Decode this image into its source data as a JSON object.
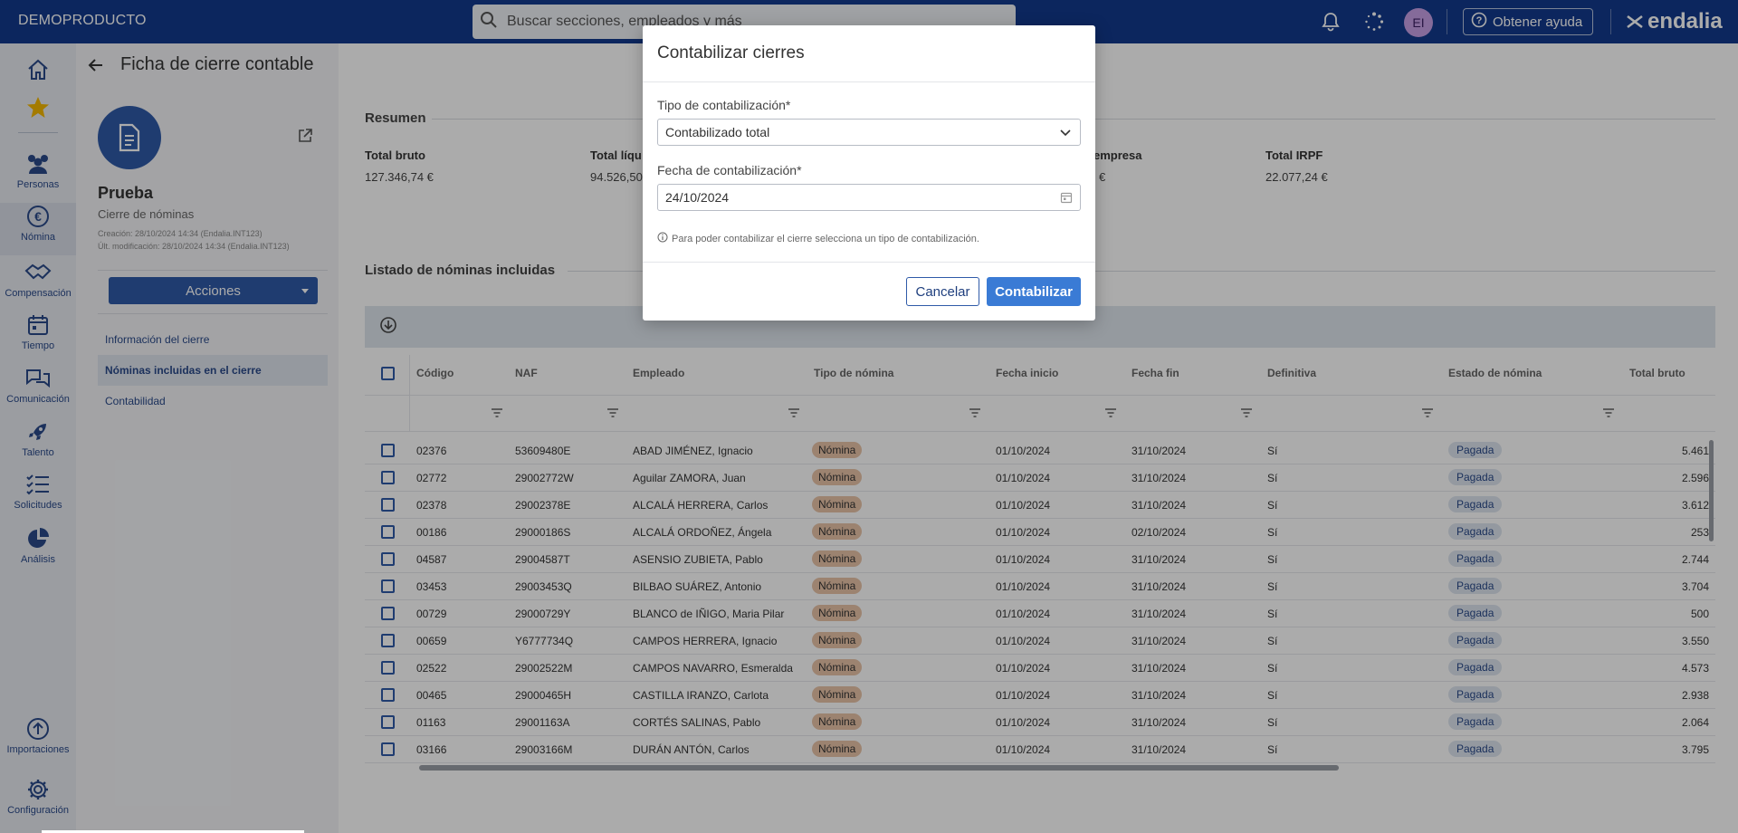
{
  "app": {
    "brand": "DEMOPRODUCTO",
    "search_placeholder": "Buscar secciones, empleados y más",
    "avatar_initials": "EI",
    "help_label": "Obtener ayuda",
    "logo_text": "endalia"
  },
  "rail": {
    "items": [
      {
        "label": "",
        "icon": "home-icon"
      },
      {
        "label": "",
        "icon": "star-icon"
      },
      {
        "label": "Personas",
        "icon": "people-icon"
      },
      {
        "label": "Nómina",
        "icon": "euro-icon"
      },
      {
        "label": "Compensación",
        "icon": "handshake-icon"
      },
      {
        "label": "Tiempo",
        "icon": "calendar-icon"
      },
      {
        "label": "Comunicación",
        "icon": "chat-icon"
      },
      {
        "label": "Talento",
        "icon": "rocket-icon"
      },
      {
        "label": "Solicitudes",
        "icon": "checklist-icon"
      },
      {
        "label": "Análisis",
        "icon": "pie-chart-icon"
      },
      {
        "label": "Importaciones",
        "icon": "upload-icon"
      },
      {
        "label": "Configuración",
        "icon": "gear-icon"
      }
    ]
  },
  "page": {
    "title": "Ficha de cierre contable",
    "record_name": "Prueba",
    "record_type": "Cierre de nóminas",
    "created": "Creación: 28/10/2024 14:34 (Endalia.INT123)",
    "modified": "Últ. modificación: 28/10/2024 14:34 (Endalia.INT123)",
    "actions_label": "Acciones",
    "nav": [
      "Información del cierre",
      "Nóminas incluidas en el cierre",
      "Contabilidad"
    ]
  },
  "summary": {
    "title": "Resumen",
    "items": [
      {
        "label": "Total bruto",
        "value": "127.346,74 €"
      },
      {
        "label": "Total líqu",
        "value": "94.526,50"
      },
      {
        "label": "empresa",
        "value": "€"
      },
      {
        "label": "Total IRPF",
        "value": "22.077,24 €"
      }
    ]
  },
  "table": {
    "title": "Listado de nóminas incluidas",
    "columns": [
      "Código",
      "NAF",
      "Empleado",
      "Tipo de nómina",
      "Fecha inicio",
      "Fecha fin",
      "Definitiva",
      "Estado de nómina",
      "Total bruto"
    ],
    "rows": [
      [
        "02376",
        "53609480E",
        "ABAD JIMÉNEZ, Ignacio",
        "Nómina",
        "01/10/2024",
        "31/10/2024",
        "Sí",
        "Pagada",
        "5.461"
      ],
      [
        "02772",
        "29002772W",
        "Aguilar ZAMORA, Juan",
        "Nómina",
        "01/10/2024",
        "31/10/2024",
        "Sí",
        "Pagada",
        "2.596"
      ],
      [
        "02378",
        "29002378E",
        "ALCALÁ HERRERA, Carlos",
        "Nómina",
        "01/10/2024",
        "31/10/2024",
        "Sí",
        "Pagada",
        "3.612"
      ],
      [
        "00186",
        "29000186S",
        "ALCALÁ ORDOÑEZ, Ángela",
        "Nómina",
        "01/10/2024",
        "02/10/2024",
        "Sí",
        "Pagada",
        "253"
      ],
      [
        "04587",
        "29004587T",
        "ASENSIO ZUBIETA, Pablo",
        "Nómina",
        "01/10/2024",
        "31/10/2024",
        "Sí",
        "Pagada",
        "2.744"
      ],
      [
        "03453",
        "29003453Q",
        "BILBAO SUÁREZ, Antonio",
        "Nómina",
        "01/10/2024",
        "31/10/2024",
        "Sí",
        "Pagada",
        "3.704"
      ],
      [
        "00729",
        "29000729Y",
        "BLANCO de IÑIGO, Maria Pilar",
        "Nómina",
        "01/10/2024",
        "31/10/2024",
        "Sí",
        "Pagada",
        "500"
      ],
      [
        "00659",
        "Y6777734Q",
        "CAMPOS HERRERA, Ignacio",
        "Nómina",
        "01/10/2024",
        "31/10/2024",
        "Sí",
        "Pagada",
        "3.550"
      ],
      [
        "02522",
        "29002522M",
        "CAMPOS NAVARRO, Esmeralda",
        "Nómina",
        "01/10/2024",
        "31/10/2024",
        "Sí",
        "Pagada",
        "4.573"
      ],
      [
        "00465",
        "29000465H",
        "CASTILLA IRANZO, Carlota",
        "Nómina",
        "01/10/2024",
        "31/10/2024",
        "Sí",
        "Pagada",
        "2.938"
      ],
      [
        "01163",
        "29001163A",
        "CORTÉS SALINAS, Pablo",
        "Nómina",
        "01/10/2024",
        "31/10/2024",
        "Sí",
        "Pagada",
        "2.064"
      ],
      [
        "03166",
        "29003166M",
        "DURÁN ANTÓN, Carlos",
        "Nómina",
        "01/10/2024",
        "31/10/2024",
        "Sí",
        "Pagada",
        "3.795"
      ]
    ]
  },
  "modal": {
    "title": "Contabilizar cierres",
    "type_label": "Tipo de contabilización*",
    "type_value": "Contabilizado total",
    "date_label": "Fecha de contabilización*",
    "date_value": "24/10/2024",
    "info": "Para poder contabilizar el cierre selecciona un tipo de contabilización.",
    "cancel_label": "Cancelar",
    "confirm_label": "Contabilizar"
  },
  "colors": {
    "topbar": "#123a8c",
    "primary": "#2f5aa8",
    "confirm": "#3a7bd5",
    "tipo_pill": "#e9c3a7"
  }
}
